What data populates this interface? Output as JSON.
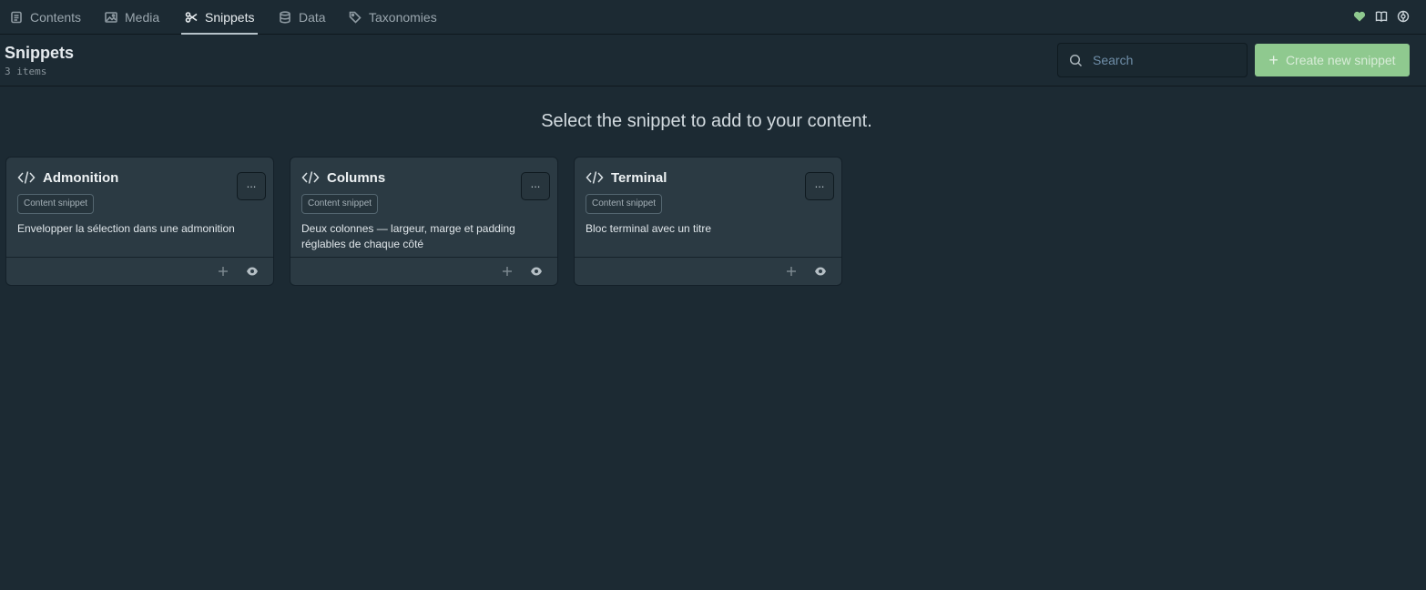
{
  "nav": {
    "tabs": [
      {
        "label": "Contents",
        "icon": "file-text-icon"
      },
      {
        "label": "Media",
        "icon": "image-icon"
      },
      {
        "label": "Snippets",
        "icon": "scissors-icon",
        "active": true
      },
      {
        "label": "Data",
        "icon": "database-icon"
      },
      {
        "label": "Taxonomies",
        "icon": "tag-icon"
      }
    ],
    "right_icons": [
      "heart-icon",
      "book-icon",
      "settings-icon"
    ]
  },
  "header": {
    "title": "Snippets",
    "count": "3 items",
    "search_placeholder": "Search",
    "create_label": "Create new snippet"
  },
  "main": {
    "instruction": "Select the snippet to add to your content."
  },
  "snippets": [
    {
      "title": "Admonition",
      "badge": "Content snippet",
      "description": "Envelopper la sélection dans une admonition",
      "menu": "..."
    },
    {
      "title": "Columns",
      "badge": "Content snippet",
      "description": "Deux colonnes — largeur, marge et padding réglables de chaque côté",
      "menu": "..."
    },
    {
      "title": "Terminal",
      "badge": "Content snippet",
      "description": "Bloc terminal avec un titre",
      "menu": "..."
    }
  ],
  "colors": {
    "background": "#1c2a33",
    "card": "#2b3a43",
    "accent": "#8fc98f",
    "heart": "#8fc98f"
  }
}
